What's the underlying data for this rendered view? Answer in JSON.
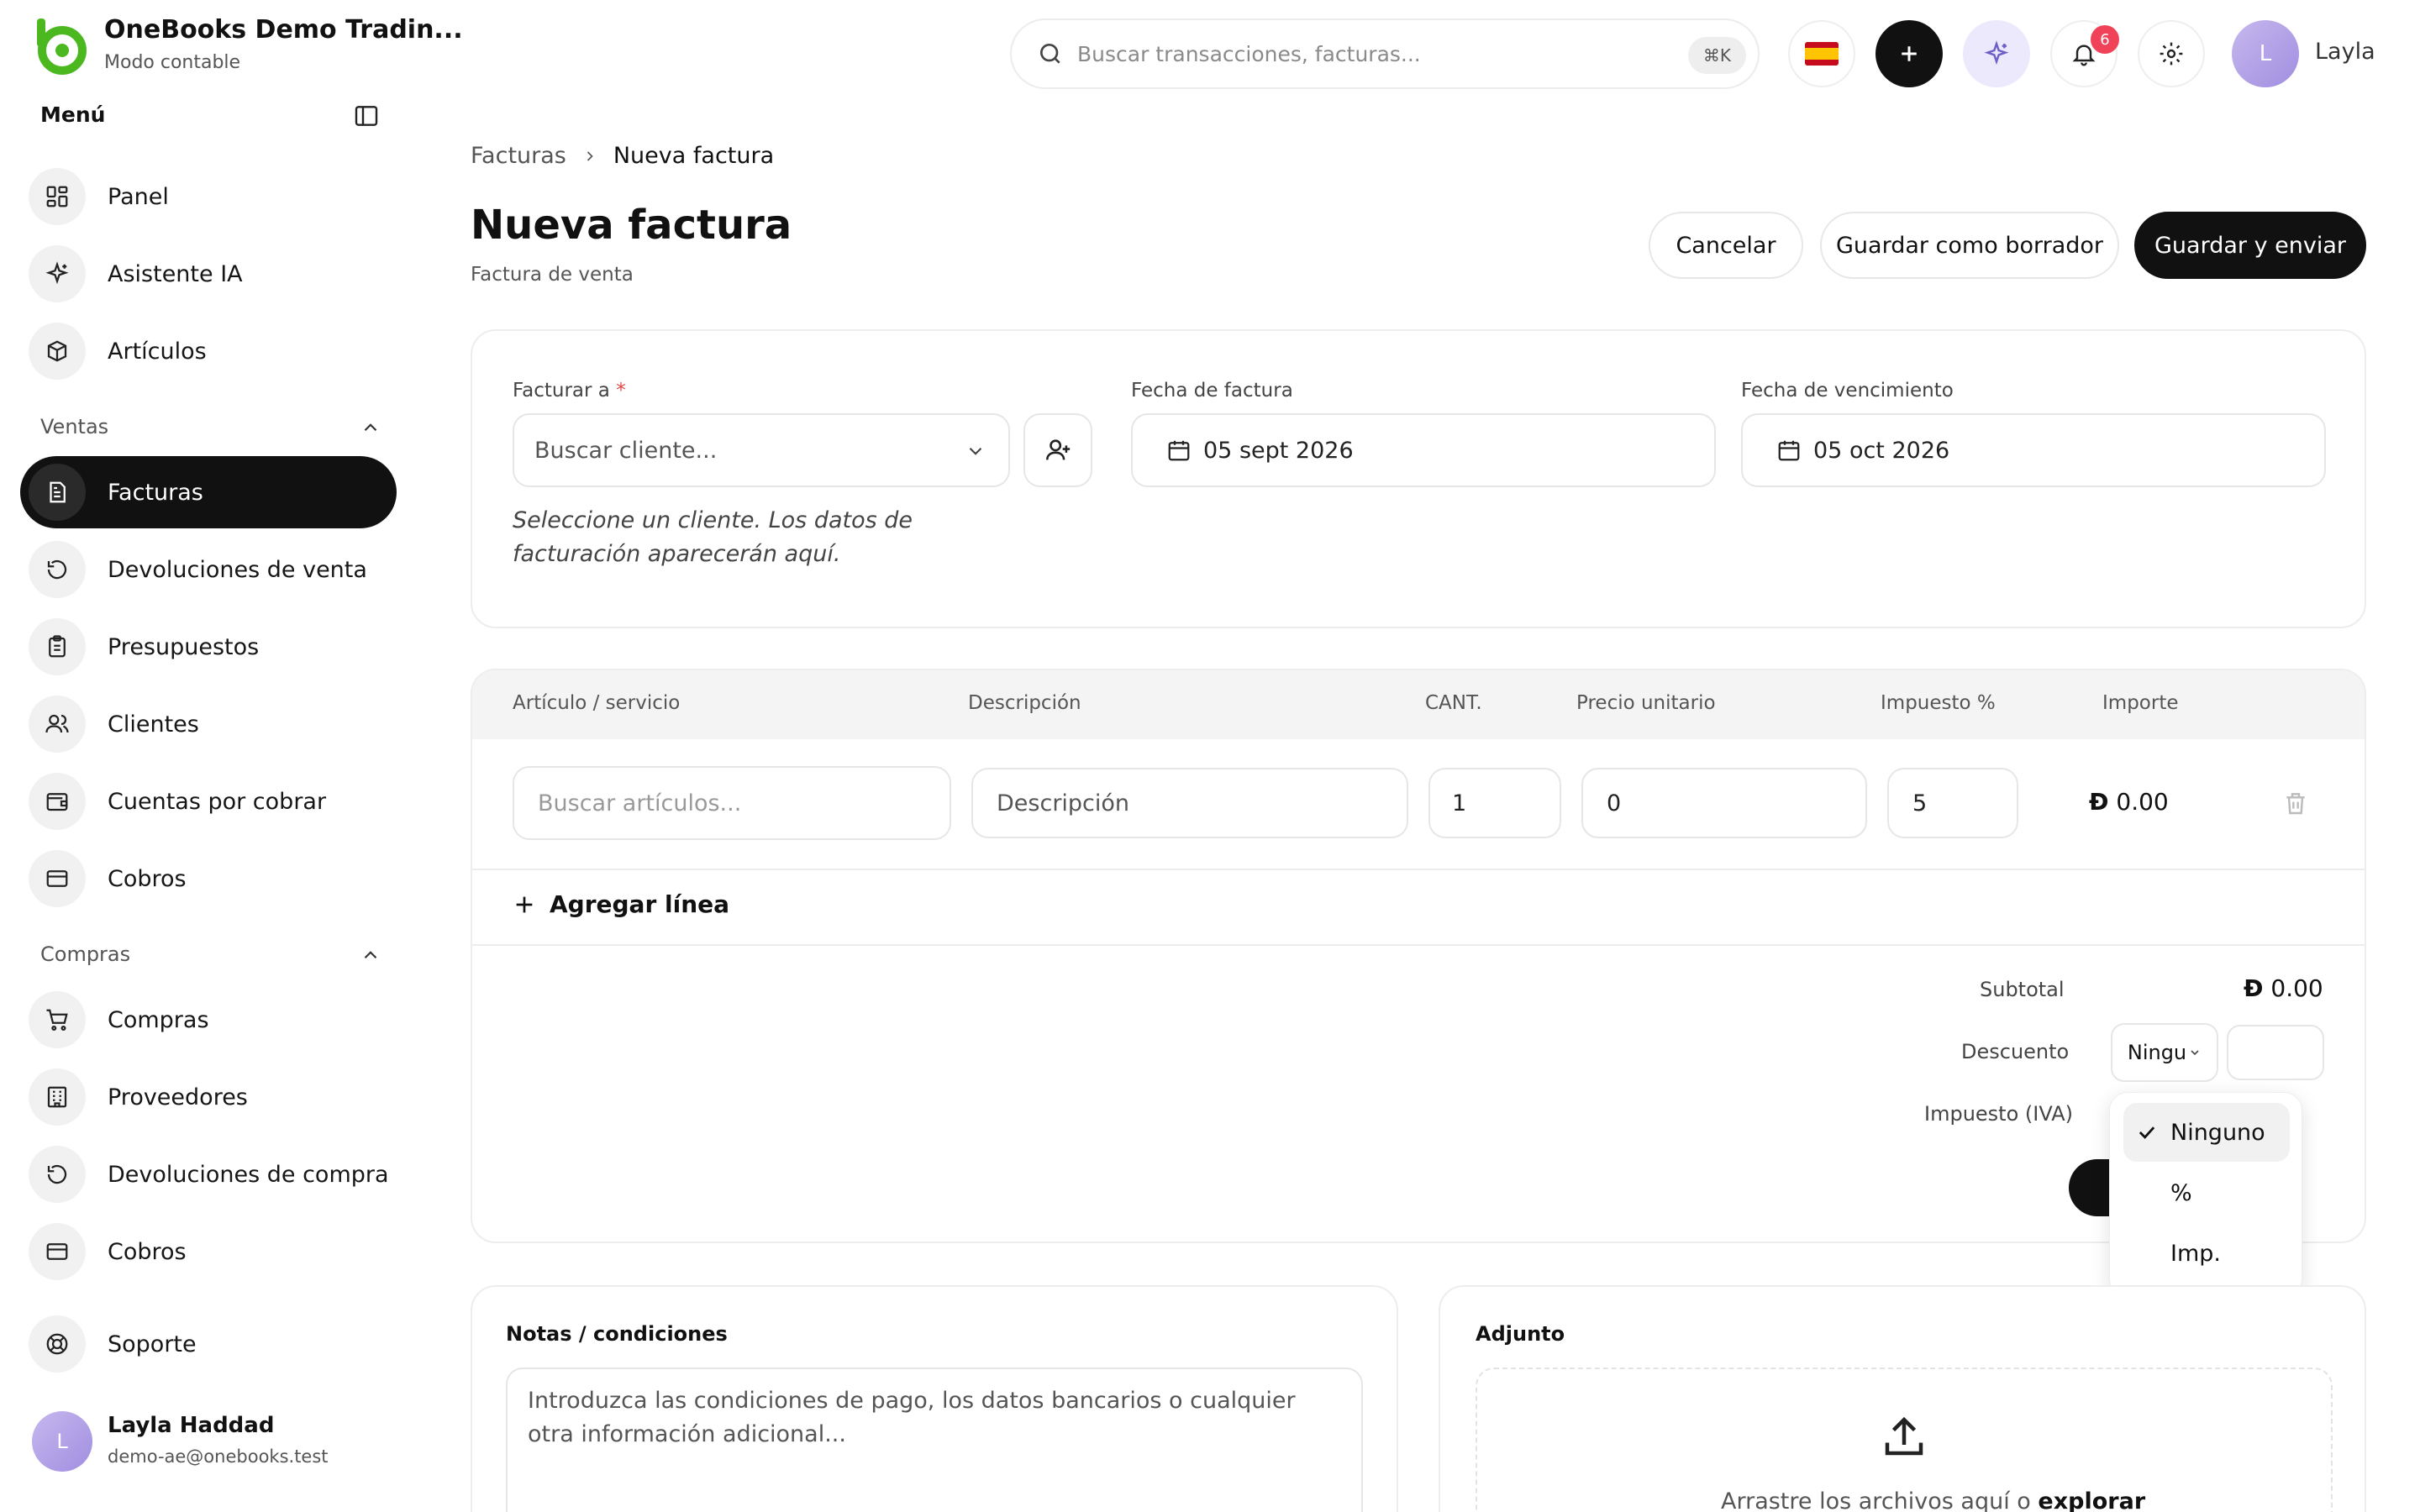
{
  "brand": {
    "title": "OneBooks Demo Tradin...",
    "subtitle": "Modo contable",
    "logo_color": "#4cb81f"
  },
  "sidebar": {
    "menu_title": "Menú",
    "top_items": [
      {
        "label": "Panel",
        "icon": "dashboard-icon"
      },
      {
        "label": "Asistente IA",
        "icon": "sparkles-icon"
      },
      {
        "label": "Artículos",
        "icon": "box-icon"
      }
    ],
    "sales_section": "Ventas",
    "sales_items": [
      {
        "label": "Facturas",
        "icon": "invoice-icon",
        "active": true
      },
      {
        "label": "Devoluciones de venta",
        "icon": "undo-icon"
      },
      {
        "label": "Presupuestos",
        "icon": "clipboard-icon"
      },
      {
        "label": "Clientes",
        "icon": "users-icon"
      },
      {
        "label": "Cuentas por cobrar",
        "icon": "wallet-icon"
      },
      {
        "label": "Cobros",
        "icon": "card-icon"
      }
    ],
    "purchases_section": "Compras",
    "purchase_items": [
      {
        "label": "Compras",
        "icon": "cart-icon"
      },
      {
        "label": "Proveedores",
        "icon": "building-icon"
      },
      {
        "label": "Devoluciones de compra",
        "icon": "undo-icon"
      },
      {
        "label": "Cobros",
        "icon": "card-icon"
      }
    ],
    "support": "Soporte",
    "user": {
      "initial": "L",
      "name": "Layla Haddad",
      "email": "demo-ae@onebooks.test"
    }
  },
  "header": {
    "search_placeholder": "Buscar transacciones, facturas...",
    "shortcut": "⌘K",
    "notifications_count": "6",
    "user_initial": "L",
    "user_name": "Layla"
  },
  "breadcrumb": {
    "parent": "Facturas",
    "current": "Nueva factura"
  },
  "page": {
    "title": "Nueva factura",
    "subtitle": "Factura de venta",
    "cancel": "Cancelar",
    "save_draft": "Guardar como borrador",
    "save_send": "Guardar y enviar"
  },
  "customer": {
    "bill_to_label": "Facturar a",
    "required_mark": "*",
    "customer_placeholder": "Buscar cliente...",
    "hint": "Seleccione un cliente. Los datos de facturación aparecerán aquí.",
    "invoice_date_label": "Fecha de factura",
    "invoice_date": "05 sept 2026",
    "due_date_label": "Fecha de vencimiento",
    "due_date": "05 oct 2026"
  },
  "lines": {
    "headers": [
      "Artículo / servicio",
      "Descripción",
      "CANT.",
      "Precio unitario",
      "Impuesto %",
      "Importe"
    ],
    "row": {
      "item_placeholder": "Buscar artículos...",
      "description_placeholder": "Descripción",
      "qty": "1",
      "price": "0",
      "tax": "5",
      "amount": "0.00"
    },
    "add_line": "Agregar línea"
  },
  "totals": {
    "subtotal_label": "Subtotal",
    "subtotal": "0.00",
    "discount_label": "Descuento",
    "discount_select": "Ningu",
    "tax_label": "Impuesto (IVA)",
    "currency_symbol": "Đ"
  },
  "discount_menu": {
    "options": [
      "Ninguno",
      "%",
      "Imp."
    ],
    "selected": "Ninguno"
  },
  "notes": {
    "title": "Notas / condiciones",
    "placeholder": "Introduzca las condiciones de pago, los datos bancarios o cualquier otra información adicional..."
  },
  "attachment": {
    "title": "Adjunto",
    "drop_text": "Arrastre los archivos aquí o ",
    "browse": "explorar"
  }
}
